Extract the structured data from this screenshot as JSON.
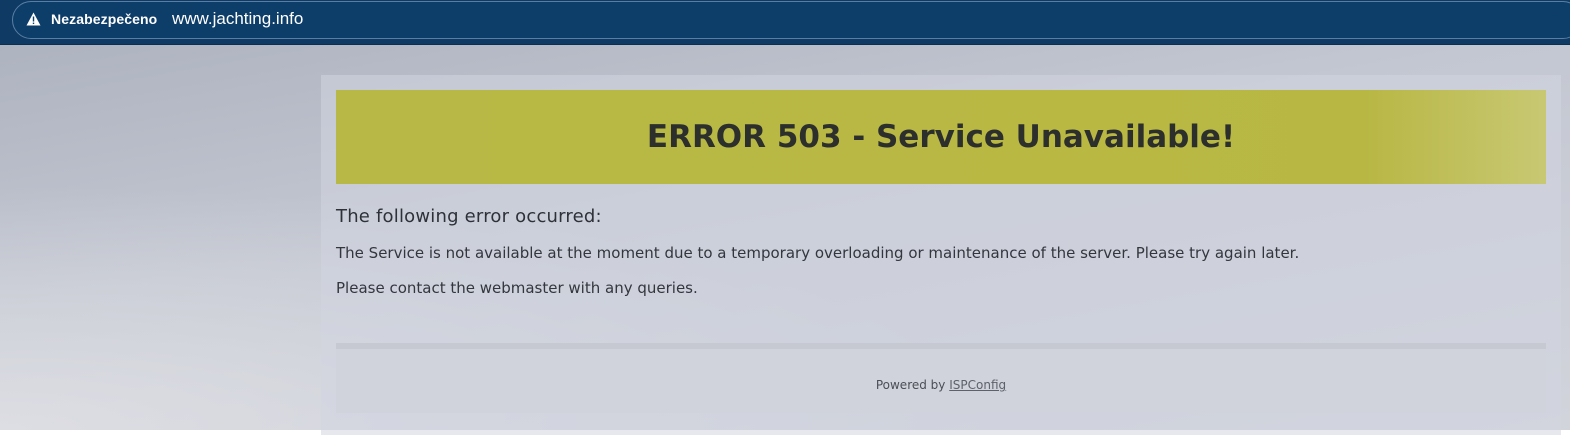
{
  "browser": {
    "security_label": "Nezabezpečeno",
    "url": "www.jachting.info",
    "security_icon": "warning-triangle-icon"
  },
  "page": {
    "error_title": "ERROR 503 - Service Unavailable!",
    "error_heading": "The following error occurred:",
    "error_message": "The Service is not available at the moment due to a temporary overloading or maintenance of the server. Please try again later.",
    "contact_message": "Please contact the webmaster with any queries.",
    "footer_prefix": "Powered by",
    "footer_link": "ISPConfig"
  },
  "colors": {
    "browser_bar": "#0e3a63",
    "banner": "#b9b843",
    "text": "#33363d"
  }
}
